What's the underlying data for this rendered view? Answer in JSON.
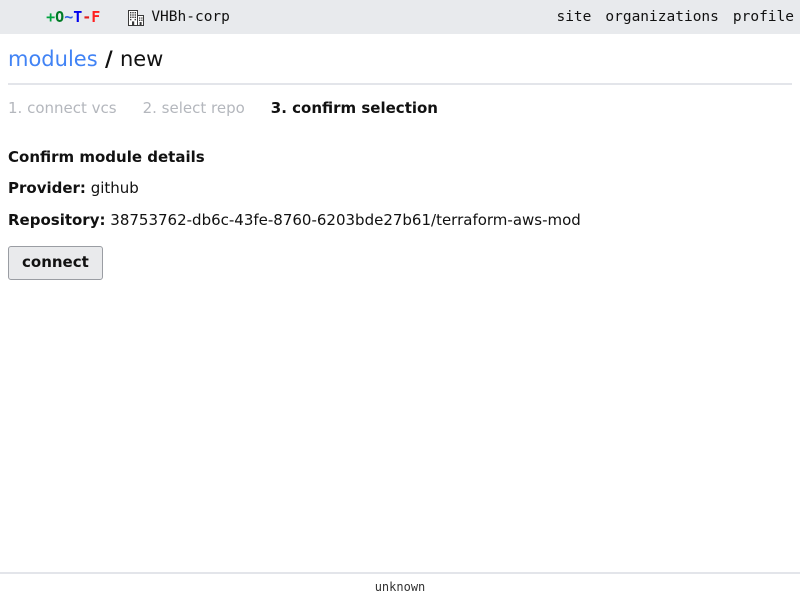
{
  "header": {
    "logo": {
      "parts": [
        {
          "char": "+",
          "color": "#00a33f"
        },
        {
          "char": "O",
          "color": "#007b25"
        },
        {
          "char": "~",
          "color": "#2b5de0"
        },
        {
          "char": "T",
          "color": "#0000ee"
        },
        {
          "char": "-",
          "color": "#e02020"
        },
        {
          "char": "F",
          "color": "#ff2020"
        }
      ],
      "text": "+O~T-F"
    },
    "organization": {
      "icon": "building-icon",
      "name": "VHBh-corp"
    },
    "nav": [
      {
        "label": "site"
      },
      {
        "label": "organizations"
      },
      {
        "label": "profile"
      }
    ]
  },
  "breadcrumb": {
    "link": "modules",
    "separator": "/",
    "current": "new"
  },
  "steps": [
    {
      "label": "1. connect vcs",
      "state": "done"
    },
    {
      "label": "2. select repo",
      "state": "done"
    },
    {
      "label": "3. confirm selection",
      "state": "current"
    }
  ],
  "main": {
    "section_title": "Confirm module details",
    "details": [
      {
        "key": "Provider:",
        "value": "github"
      },
      {
        "key": "Repository:",
        "value": "38753762-db6c-43fe-8760-6203bde27b61/terraform-aws-mod"
      }
    ],
    "connect_label": "connect"
  },
  "footer": {
    "version": "unknown"
  },
  "colors": {
    "header_bg": "#e8eaed",
    "link": "#4183f5",
    "muted": "#b4b7bd",
    "rule": "#e3e5ea",
    "button_bg": "#e9eaec",
    "button_border": "#9a9da3"
  }
}
